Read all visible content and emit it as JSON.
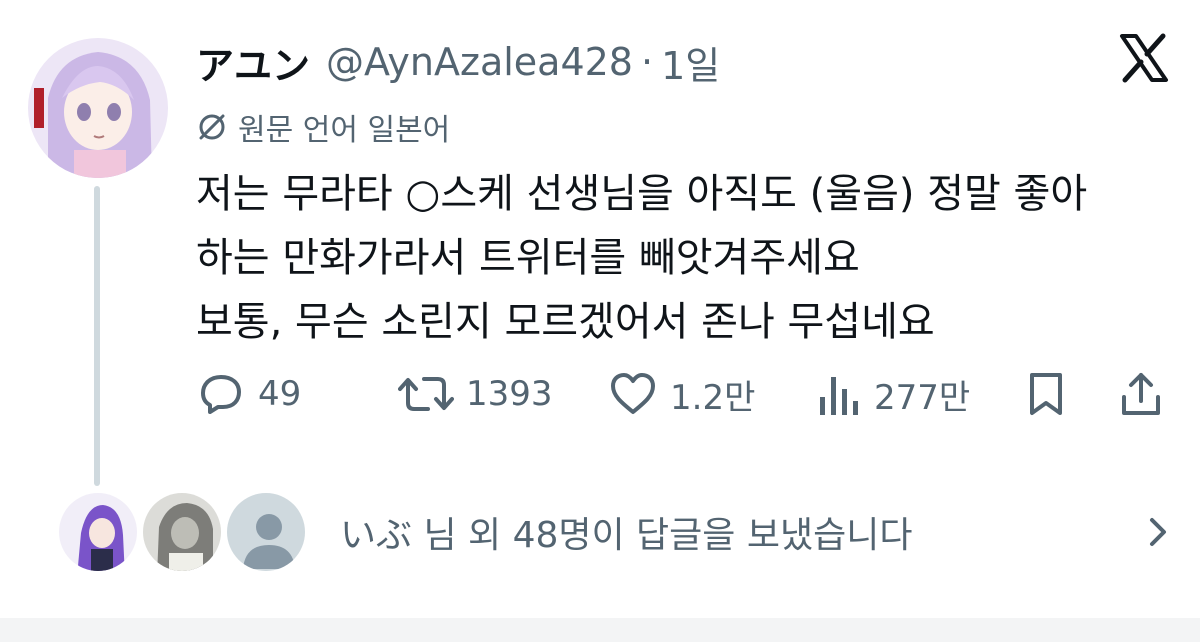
{
  "tweet": {
    "display_name": "アユン",
    "handle": "@AynAzalea428",
    "separator": "·",
    "time": "1일",
    "translate_label": "원문 언어 일본어",
    "body_lines": [
      "저는 무라타 ○스케 선생님을 아직도 (울음) 정말 좋아",
      "하는 만화가라서 트위터를 빼앗겨주세요",
      "보통, 무슨 소린지 모르겠어서 존나 무섭네요"
    ],
    "actions": {
      "replies": "49",
      "retweets": "1393",
      "likes": "1.2만",
      "views": "277만"
    },
    "replies_summary": "いぶ 님 외 48명이 답글을 보냈습니다"
  },
  "icons": {
    "brand": "x-logo-icon",
    "translate": "translate-globe-icon",
    "reply": "reply-bubble-icon",
    "retweet": "retweet-icon",
    "like": "heart-icon",
    "views": "views-bars-icon",
    "bookmark": "bookmark-icon",
    "share": "share-icon",
    "chevron": "chevron-right-icon"
  },
  "colors": {
    "text_primary": "#0f1419",
    "text_secondary": "#536471",
    "thread_line": "#cfd9de"
  }
}
